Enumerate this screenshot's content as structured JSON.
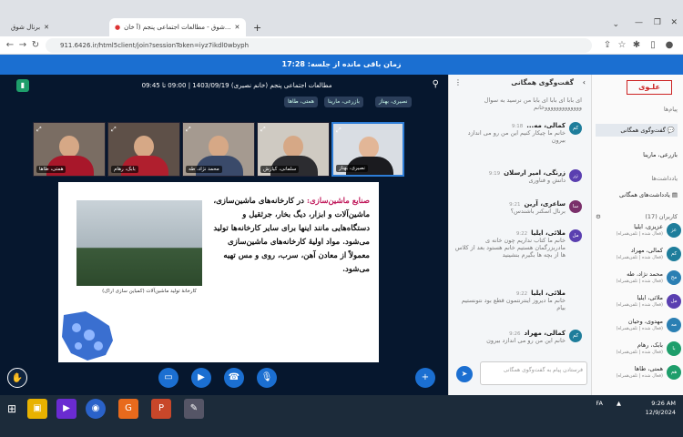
{
  "browser": {
    "tabs": [
      {
        "label": "برنال شوق",
        "active": false
      },
      {
        "label": "شوق - مطالعات اجتماعی پنجم (آ خان...",
        "active": true
      }
    ],
    "new_tab": "+",
    "url": "911.6426.ir/html5client/join?sessionToken=iyz7ikdl0wbyph"
  },
  "timer": {
    "text": "زمان باقی مانده از جلسه: 17:28"
  },
  "meeting": {
    "title": "مطالعات اجتماعی پنجم (خانم نصیری) 1403/09/19 | 09:00 تا 09:45",
    "presenter_chips": [
      "نصیری، بهناز",
      "بازرعی، مارینا",
      "همتی، طاها"
    ],
    "videos": [
      {
        "name": "نصیری، بهناز",
        "active": true
      },
      {
        "name": "سلمانی، کیارش",
        "active": false
      },
      {
        "name": "محمد نژاد، طه",
        "active": false
      },
      {
        "name": "بابک، رهام",
        "active": false
      },
      {
        "name": "همتی، طاها",
        "active": false
      }
    ],
    "slide": {
      "heading": "صنایع ماشین‌سازی:",
      "body": "در کارخانه‌های ماشین‌سازی، ماشین‌آلات و ابزار، دیگ بخار، جرثقیل و دستگاه‌هایی مانند اینها برای سایر کارخانه‌ها تولید می‌شود. مواد اولیهٔ کارخانه‌های ماشین‌سازی معمولاً از معادن آهن، سرب، روی و مس تهیه می‌شود.",
      "caption": "کارخانهٔ تولید ماشین‌آلات (کمباین سازی اراک)"
    }
  },
  "chat": {
    "title": "گفت‌وگوی همگانی",
    "messages": [
      {
        "who": "",
        "time": "",
        "text": "ای بابا ای بابا ای بابا من نرسید به سوال وووووووووووووخانم"
      },
      {
        "who": "کمالی، مه...",
        "time": "9:18",
        "text": "خانم ما چیکار کنیم این من رو می اندازد بیرون"
      },
      {
        "who": "زرنگی، امیر ارسلان",
        "time": "9:19",
        "text": "دانش و فناوری"
      },
      {
        "who": "ساعری، آرین",
        "time": "9:21",
        "text": "برنال اسکنر باشندس؟"
      },
      {
        "who": "ملائی، ایلیا",
        "time": "9:22",
        "text": "خانم ما کتاب نداریم چون خانه ی مادربزرگمان هستیم خانم هستود بعد از کلاس ها از بچه ها بگیرم بنشینید"
      },
      {
        "who": "ملائی، ایلیا",
        "time": "9:22",
        "text": "خانم ما دیروز اینترنتمون قطع بود نتونستیم بیام"
      },
      {
        "who": "کمالی، مهراد",
        "time": "9:26",
        "text": "خانم این من رو می اندازد بیرون"
      }
    ],
    "input_placeholder": "فرستادن پیام به گفت‌وگوی همگانی"
  },
  "sidebar": {
    "logo": "علـوی",
    "section_messages": "پیام‌ها",
    "public_chat": "گفت‌وگوی همگانی",
    "private_chat": "بازرعی، مارینا",
    "section_notes": "یادداشت‌ها",
    "shared_notes": "یادداشت‌های همگانی",
    "users_header": "کاربران (17)",
    "users": [
      {
        "initials": "عز",
        "name": "عزیزی، ایلیا",
        "status": "(فعال شده | تلفن‌همراه)"
      },
      {
        "initials": "کم",
        "name": "کمالی، مهراد",
        "status": "(فعال شده | تلفن‌همراه)"
      },
      {
        "initials": "مح",
        "name": "محمد نژاد، طه",
        "status": "(فعال شده | تلفن‌همراه)"
      },
      {
        "initials": "مل",
        "name": "ملائی، ایلیا",
        "status": "(فعال شده | تلفن‌همراه)"
      },
      {
        "initials": "مه",
        "name": "مهدوی، وحیان",
        "status": "(فعال شده | تلفن‌همراه)"
      },
      {
        "initials": "با",
        "name": "بابک، رهام",
        "status": "(فعال شده | تلفن‌همراه)"
      },
      {
        "initials": "هم",
        "name": "همتی، طاها",
        "status": "(فعال شده | تلفن‌همراه)"
      }
    ]
  },
  "taskbar": {
    "lang": "FA",
    "time": "9:26 AM",
    "date": "12/9/2024"
  }
}
